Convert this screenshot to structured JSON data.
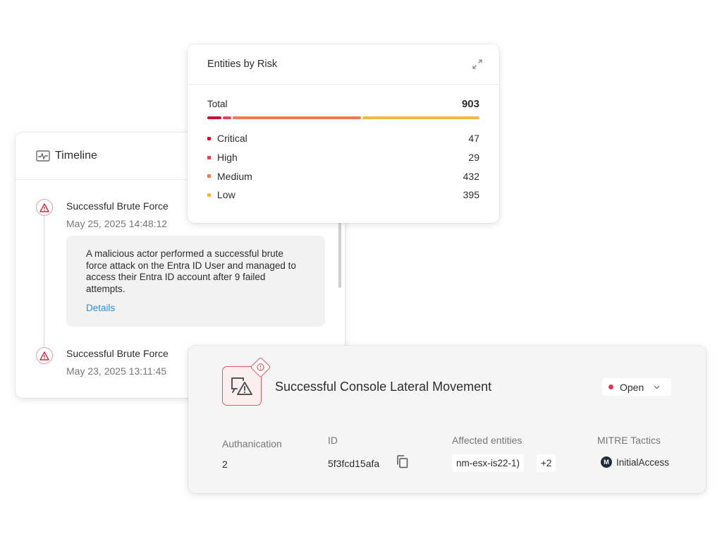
{
  "timeline": {
    "title": "Timeline",
    "events": [
      {
        "title": "Successful Brute Force",
        "time": "May 25, 2025 14:48:12",
        "description": "A malicious actor performed a successful brute force attack on the Entra ID User and managed to access their Entra ID account after 9 failed attempts.",
        "details_link": "Details"
      },
      {
        "title": "Successful Brute Force",
        "time": "May 23, 2025 13:11:45"
      }
    ]
  },
  "risk": {
    "title": "Entities by Risk",
    "total_label": "Total",
    "total_value": "903",
    "levels": [
      {
        "label": "Critical",
        "value": "47",
        "color": "#c8102e"
      },
      {
        "label": "High",
        "value": "29",
        "color": "#e8435a"
      },
      {
        "label": "Medium",
        "value": "432",
        "color": "#f4794f"
      },
      {
        "label": "Low",
        "value": "395",
        "color": "#f6b740"
      }
    ]
  },
  "detection": {
    "title": "Successful Console Lateral Movement",
    "status": "Open",
    "status_color": "#e0384a",
    "accent_color": "#e05a66",
    "fields": {
      "authentication_label": "Authanication",
      "authentication_value": "2",
      "id_label": "ID",
      "id_value": "5f3fcd15afa",
      "entities_label": "Affected entities",
      "entity_chip": "nm-esx-is22-1)",
      "entity_more": "+2",
      "mitre_label": "MITRE Tactics",
      "mitre_logo": "M",
      "mitre_value": "InitialAccess"
    }
  }
}
